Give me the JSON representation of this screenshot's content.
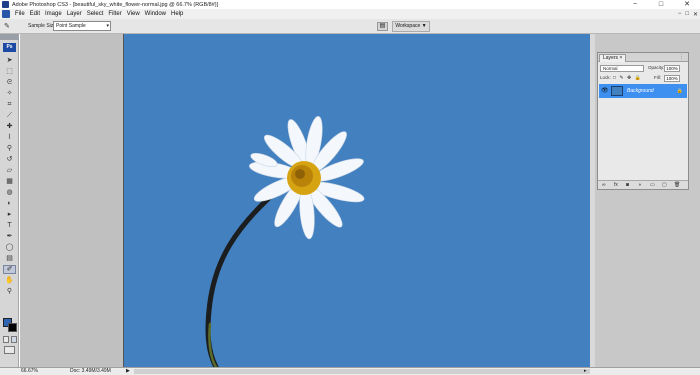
{
  "window": {
    "title": "Adobe Photoshop CS3 - [beautiful_sky_white_flower-normal.jpg @ 66.7% (RGB/8#)]",
    "minimize_glyph": "−",
    "maximize_glyph": "□",
    "close_glyph": "✕"
  },
  "menubar": {
    "items": [
      "File",
      "Edit",
      "Image",
      "Layer",
      "Select",
      "Filter",
      "View",
      "Window",
      "Help"
    ],
    "mdi_minimize": "−",
    "mdi_restore": "□",
    "mdi_close": "✕"
  },
  "options": {
    "tool_glyph": "✎",
    "sample_size_label": "Sample Size:",
    "sample_size_value": "Point Sample",
    "dropdown_arrow": "▾",
    "dock_glyph": "▤",
    "workspace_label": "Workspace ▼"
  },
  "toolbox": {
    "logo": "Ps",
    "tools": [
      {
        "name": "move-tool",
        "glyph": "➤"
      },
      {
        "name": "marquee-tool",
        "glyph": "⬚"
      },
      {
        "name": "lasso-tool",
        "glyph": "ᘓ"
      },
      {
        "name": "magic-wand-tool",
        "glyph": "✧"
      },
      {
        "name": "crop-tool",
        "glyph": "⌗"
      },
      {
        "name": "slice-tool",
        "glyph": "⟋"
      },
      {
        "name": "healing-brush-tool",
        "glyph": "✚"
      },
      {
        "name": "brush-tool",
        "glyph": "⌇"
      },
      {
        "name": "clone-stamp-tool",
        "glyph": "⚲"
      },
      {
        "name": "history-brush-tool",
        "glyph": "↺"
      },
      {
        "name": "eraser-tool",
        "glyph": "▱"
      },
      {
        "name": "gradient-tool",
        "glyph": "▦"
      },
      {
        "name": "blur-tool",
        "glyph": "◍"
      },
      {
        "name": "dodge-tool",
        "glyph": "◐"
      },
      {
        "name": "path-selection-tool",
        "glyph": "▸"
      },
      {
        "name": "type-tool",
        "glyph": "T"
      },
      {
        "name": "pen-tool",
        "glyph": "✒"
      },
      {
        "name": "shape-tool",
        "glyph": "◯"
      },
      {
        "name": "notes-tool",
        "glyph": "▤"
      },
      {
        "name": "eyedropper-tool",
        "glyph": "✐",
        "active": true
      },
      {
        "name": "hand-tool",
        "glyph": "✋"
      },
      {
        "name": "zoom-tool",
        "glyph": "⚲"
      }
    ]
  },
  "layers_panel": {
    "tab_label": "Layers ×",
    "menu_glyph": "⋮",
    "blend_mode": "Normal",
    "opacity_label": "Opacity:",
    "opacity_value": "100%",
    "lock_label": "Lock:",
    "lock_icons": "□ ✎ ✥ 🔒",
    "fill_label": "Fill:",
    "fill_value": "100%",
    "eye_glyph": "👁",
    "layer_name": "Background",
    "layer_lock_glyph": "🔒",
    "footer_icons": [
      "∞",
      "fx",
      "◙",
      "◑",
      "▭",
      "▢",
      "🗑"
    ]
  },
  "status": {
    "zoom": "66.67%",
    "doc": "Doc: 3.49M/3.49M",
    "arrow": "▶",
    "scroll_left": "◂",
    "scroll_right": "▸"
  },
  "colors": {
    "sky": "#4280bf",
    "workspace": "#c0c0c0",
    "layer_selected": "#3d8ff0",
    "foreground_swatch": "#2e66b3",
    "background_swatch": "#000000"
  }
}
